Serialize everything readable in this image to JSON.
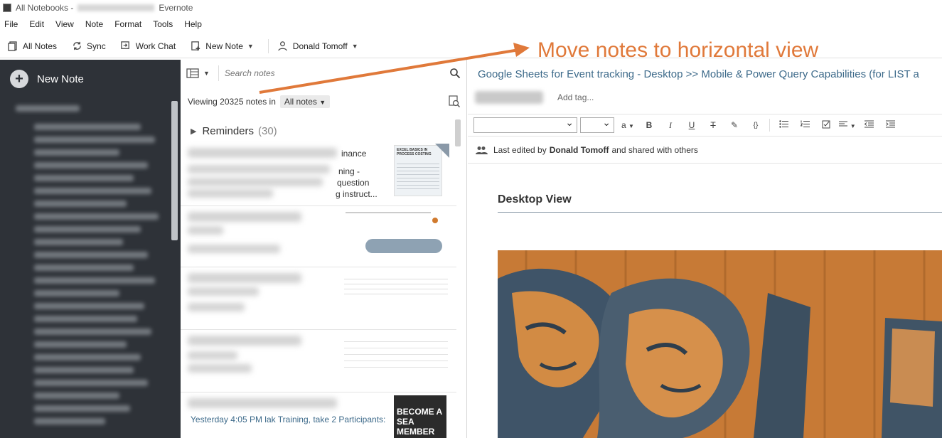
{
  "window": {
    "title_prefix": "All Notebooks -",
    "title_suffix": "Evernote"
  },
  "menu": [
    "File",
    "Edit",
    "View",
    "Note",
    "Format",
    "Tools",
    "Help"
  ],
  "toolbar": {
    "all_notes": "All Notes",
    "sync": "Sync",
    "work_chat": "Work Chat",
    "new_note": "New Note",
    "user": "Donald Tomoff"
  },
  "sidebar": {
    "new_note": "New Note",
    "bg_color": "#2e3238"
  },
  "notelist": {
    "search_placeholder": "Search notes",
    "viewing_text": "Viewing 20325 notes in",
    "scope": "All notes",
    "reminders_label": "Reminders",
    "reminders_count": "(30)",
    "cards": [
      {
        "lines": [
          "inance",
          "ning -",
          "question",
          "g instruct..."
        ],
        "thumb_title": "EXCEL BASICS IN PROCESS COSTING"
      },
      {
        "lines": [],
        "thumb_title": ""
      },
      {
        "lines": [],
        "thumb_title": ""
      },
      {
        "lines": [],
        "thumb_title": ""
      },
      {
        "lines": [
          "Yesterday 4:05 PM  lak  Training, take 2 Participants:"
        ],
        "thumb_title": "BECOME A SEA MEMBER TODA"
      }
    ]
  },
  "editor": {
    "title": "Google Sheets for Event tracking - Desktop >> Mobile & Power Query Capabilities (for LIST a",
    "add_tag": "Add tag...",
    "shared_prefix": "Last edited by",
    "shared_user": "Donald Tomoff",
    "shared_suffix": "and shared with others",
    "heading": "Desktop View",
    "format_buttons": [
      "a",
      "B",
      "I",
      "U",
      "T",
      "✎",
      "{}"
    ]
  },
  "annotation": {
    "text": "Move notes to horizontal view",
    "color": "#e0793a"
  }
}
